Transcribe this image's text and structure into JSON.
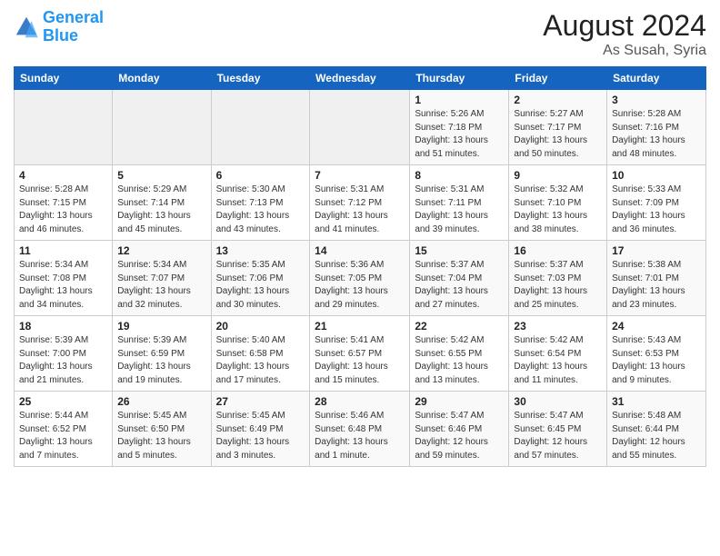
{
  "logo": {
    "line1": "General",
    "line2": "Blue"
  },
  "title": "August 2024",
  "subtitle": "As Susah, Syria",
  "days_of_week": [
    "Sunday",
    "Monday",
    "Tuesday",
    "Wednesday",
    "Thursday",
    "Friday",
    "Saturday"
  ],
  "weeks": [
    [
      {
        "day": "",
        "info": ""
      },
      {
        "day": "",
        "info": ""
      },
      {
        "day": "",
        "info": ""
      },
      {
        "day": "",
        "info": ""
      },
      {
        "day": "1",
        "info": "Sunrise: 5:26 AM\nSunset: 7:18 PM\nDaylight: 13 hours\nand 51 minutes."
      },
      {
        "day": "2",
        "info": "Sunrise: 5:27 AM\nSunset: 7:17 PM\nDaylight: 13 hours\nand 50 minutes."
      },
      {
        "day": "3",
        "info": "Sunrise: 5:28 AM\nSunset: 7:16 PM\nDaylight: 13 hours\nand 48 minutes."
      }
    ],
    [
      {
        "day": "4",
        "info": "Sunrise: 5:28 AM\nSunset: 7:15 PM\nDaylight: 13 hours\nand 46 minutes."
      },
      {
        "day": "5",
        "info": "Sunrise: 5:29 AM\nSunset: 7:14 PM\nDaylight: 13 hours\nand 45 minutes."
      },
      {
        "day": "6",
        "info": "Sunrise: 5:30 AM\nSunset: 7:13 PM\nDaylight: 13 hours\nand 43 minutes."
      },
      {
        "day": "7",
        "info": "Sunrise: 5:31 AM\nSunset: 7:12 PM\nDaylight: 13 hours\nand 41 minutes."
      },
      {
        "day": "8",
        "info": "Sunrise: 5:31 AM\nSunset: 7:11 PM\nDaylight: 13 hours\nand 39 minutes."
      },
      {
        "day": "9",
        "info": "Sunrise: 5:32 AM\nSunset: 7:10 PM\nDaylight: 13 hours\nand 38 minutes."
      },
      {
        "day": "10",
        "info": "Sunrise: 5:33 AM\nSunset: 7:09 PM\nDaylight: 13 hours\nand 36 minutes."
      }
    ],
    [
      {
        "day": "11",
        "info": "Sunrise: 5:34 AM\nSunset: 7:08 PM\nDaylight: 13 hours\nand 34 minutes."
      },
      {
        "day": "12",
        "info": "Sunrise: 5:34 AM\nSunset: 7:07 PM\nDaylight: 13 hours\nand 32 minutes."
      },
      {
        "day": "13",
        "info": "Sunrise: 5:35 AM\nSunset: 7:06 PM\nDaylight: 13 hours\nand 30 minutes."
      },
      {
        "day": "14",
        "info": "Sunrise: 5:36 AM\nSunset: 7:05 PM\nDaylight: 13 hours\nand 29 minutes."
      },
      {
        "day": "15",
        "info": "Sunrise: 5:37 AM\nSunset: 7:04 PM\nDaylight: 13 hours\nand 27 minutes."
      },
      {
        "day": "16",
        "info": "Sunrise: 5:37 AM\nSunset: 7:03 PM\nDaylight: 13 hours\nand 25 minutes."
      },
      {
        "day": "17",
        "info": "Sunrise: 5:38 AM\nSunset: 7:01 PM\nDaylight: 13 hours\nand 23 minutes."
      }
    ],
    [
      {
        "day": "18",
        "info": "Sunrise: 5:39 AM\nSunset: 7:00 PM\nDaylight: 13 hours\nand 21 minutes."
      },
      {
        "day": "19",
        "info": "Sunrise: 5:39 AM\nSunset: 6:59 PM\nDaylight: 13 hours\nand 19 minutes."
      },
      {
        "day": "20",
        "info": "Sunrise: 5:40 AM\nSunset: 6:58 PM\nDaylight: 13 hours\nand 17 minutes."
      },
      {
        "day": "21",
        "info": "Sunrise: 5:41 AM\nSunset: 6:57 PM\nDaylight: 13 hours\nand 15 minutes."
      },
      {
        "day": "22",
        "info": "Sunrise: 5:42 AM\nSunset: 6:55 PM\nDaylight: 13 hours\nand 13 minutes."
      },
      {
        "day": "23",
        "info": "Sunrise: 5:42 AM\nSunset: 6:54 PM\nDaylight: 13 hours\nand 11 minutes."
      },
      {
        "day": "24",
        "info": "Sunrise: 5:43 AM\nSunset: 6:53 PM\nDaylight: 13 hours\nand 9 minutes."
      }
    ],
    [
      {
        "day": "25",
        "info": "Sunrise: 5:44 AM\nSunset: 6:52 PM\nDaylight: 13 hours\nand 7 minutes."
      },
      {
        "day": "26",
        "info": "Sunrise: 5:45 AM\nSunset: 6:50 PM\nDaylight: 13 hours\nand 5 minutes."
      },
      {
        "day": "27",
        "info": "Sunrise: 5:45 AM\nSunset: 6:49 PM\nDaylight: 13 hours\nand 3 minutes."
      },
      {
        "day": "28",
        "info": "Sunrise: 5:46 AM\nSunset: 6:48 PM\nDaylight: 13 hours\nand 1 minute."
      },
      {
        "day": "29",
        "info": "Sunrise: 5:47 AM\nSunset: 6:46 PM\nDaylight: 12 hours\nand 59 minutes."
      },
      {
        "day": "30",
        "info": "Sunrise: 5:47 AM\nSunset: 6:45 PM\nDaylight: 12 hours\nand 57 minutes."
      },
      {
        "day": "31",
        "info": "Sunrise: 5:48 AM\nSunset: 6:44 PM\nDaylight: 12 hours\nand 55 minutes."
      }
    ]
  ]
}
